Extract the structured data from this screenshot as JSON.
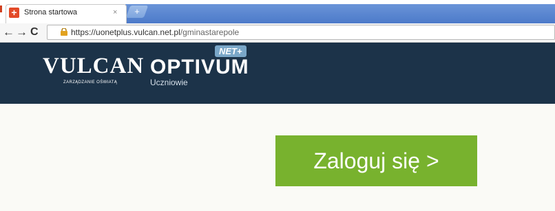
{
  "browser": {
    "tab_title": "Strona startowa",
    "tab_close": "×",
    "favicon_glyph": "+",
    "new_tab_glyph": "+",
    "url_host": "https://uonetplus.vulcan.net.pl",
    "url_path": "/gminastarepole",
    "nav": {
      "back": "←",
      "forward": "→",
      "reload": "C"
    }
  },
  "header": {
    "vulcan_name": "VULCAN",
    "vulcan_tagline": "ZARZĄDZANIE OŚWIATĄ",
    "optivum_badge": "NET+",
    "optivum_name": "OPTIVUM",
    "optivum_sub": "Uczniowie"
  },
  "main": {
    "login_label": "Zaloguj się >"
  },
  "colors": {
    "header_bg": "#1c3349",
    "login_bg": "#78b22e",
    "page_bg": "#fafaf6"
  }
}
